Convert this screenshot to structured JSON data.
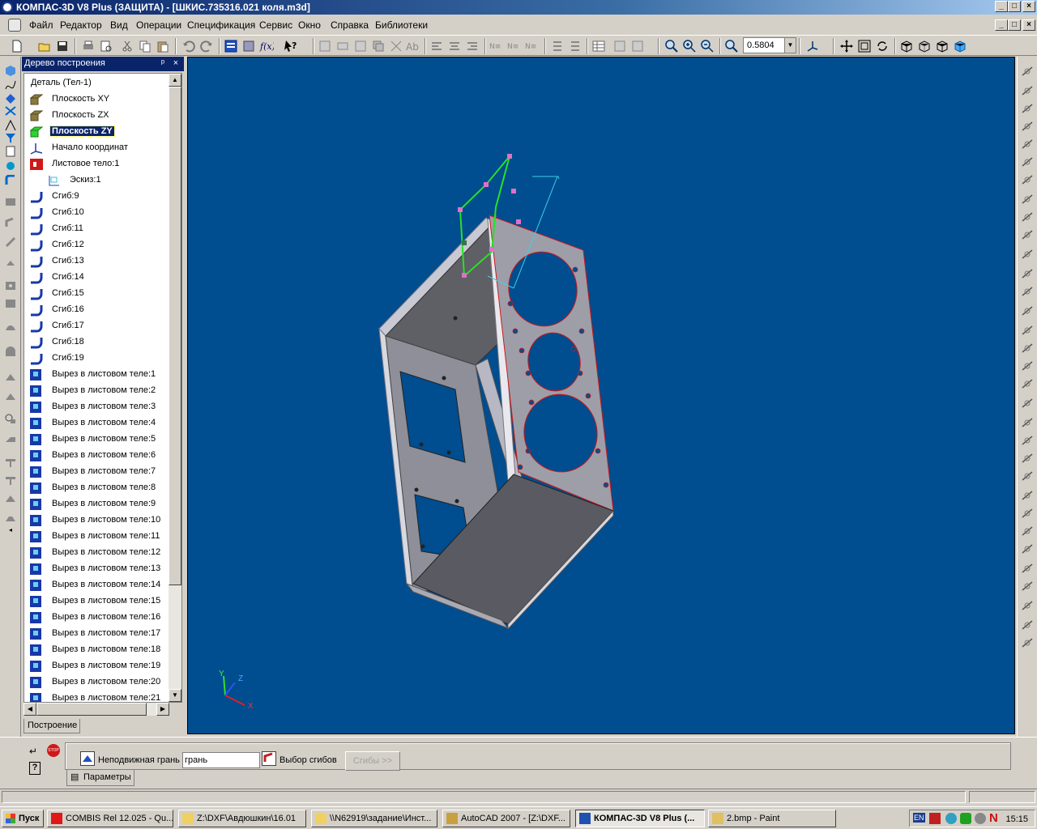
{
  "window": {
    "title": "КОМПАС-3D V8 Plus (ЗАЩИТА) - [ШКИС.735316.021 коля.m3d]",
    "controls": [
      "_",
      "□",
      "×"
    ]
  },
  "menu": {
    "items": [
      "Файл",
      "Редактор",
      "Вид",
      "Операции",
      "Спецификация",
      "Сервис",
      "Окно",
      "Справка",
      "Библиотеки"
    ]
  },
  "toolbar": {
    "zoom_value": "0.5804"
  },
  "tree": {
    "title": "Дерево построения",
    "pin": "ᵖ",
    "close": "×",
    "root": "Деталь (Тел-1)",
    "items": [
      {
        "label": "Плоскость XY",
        "icon": "plane-icon"
      },
      {
        "label": "Плоскость ZX",
        "icon": "plane-icon"
      },
      {
        "label": "Плоскость ZY",
        "icon": "plane-icon",
        "selected": true
      },
      {
        "label": "Начало координат",
        "icon": "origin-icon"
      },
      {
        "label": "Листовое тело:1",
        "icon": "sheet-body-icon"
      },
      {
        "label": "Эскиз:1",
        "icon": "sketch-icon",
        "indent": true
      },
      {
        "label": "Сгиб:9",
        "icon": "bend-icon"
      },
      {
        "label": "Сгиб:10",
        "icon": "bend-icon"
      },
      {
        "label": "Сгиб:11",
        "icon": "bend-icon"
      },
      {
        "label": "Сгиб:12",
        "icon": "bend-icon"
      },
      {
        "label": "Сгиб:13",
        "icon": "bend-icon"
      },
      {
        "label": "Сгиб:14",
        "icon": "bend-icon"
      },
      {
        "label": "Сгиб:15",
        "icon": "bend-icon"
      },
      {
        "label": "Сгиб:16",
        "icon": "bend-icon"
      },
      {
        "label": "Сгиб:17",
        "icon": "bend-icon"
      },
      {
        "label": "Сгиб:18",
        "icon": "bend-icon"
      },
      {
        "label": "Сгиб:19",
        "icon": "bend-icon"
      },
      {
        "label": "Вырез в листовом теле:1",
        "icon": "cutout-icon"
      },
      {
        "label": "Вырез в листовом теле:2",
        "icon": "cutout-icon"
      },
      {
        "label": "Вырез в листовом теле:3",
        "icon": "cutout-icon"
      },
      {
        "label": "Вырез в листовом теле:4",
        "icon": "cutout-icon"
      },
      {
        "label": "Вырез в листовом теле:5",
        "icon": "cutout-icon"
      },
      {
        "label": "Вырез в листовом теле:6",
        "icon": "cutout-icon"
      },
      {
        "label": "Вырез в листовом теле:7",
        "icon": "cutout-icon"
      },
      {
        "label": "Вырез в листовом теле:8",
        "icon": "cutout-icon"
      },
      {
        "label": "Вырез в листовом теле:9",
        "icon": "cutout-icon"
      },
      {
        "label": "Вырез в листовом теле:10",
        "icon": "cutout-icon"
      },
      {
        "label": "Вырез в листовом теле:11",
        "icon": "cutout-icon"
      },
      {
        "label": "Вырез в листовом теле:12",
        "icon": "cutout-icon"
      },
      {
        "label": "Вырез в листовом теле:13",
        "icon": "cutout-icon"
      },
      {
        "label": "Вырез в листовом теле:14",
        "icon": "cutout-icon"
      },
      {
        "label": "Вырез в листовом теле:15",
        "icon": "cutout-icon"
      },
      {
        "label": "Вырез в листовом теле:16",
        "icon": "cutout-icon"
      },
      {
        "label": "Вырез в листовом теле:17",
        "icon": "cutout-icon"
      },
      {
        "label": "Вырез в листовом теле:18",
        "icon": "cutout-icon"
      },
      {
        "label": "Вырез в листовом теле:19",
        "icon": "cutout-icon"
      },
      {
        "label": "Вырез в листовом теле:20",
        "icon": "cutout-icon"
      },
      {
        "label": "Вырез в листовом теле:21",
        "icon": "cutout-icon"
      }
    ],
    "tab_label": "Построение"
  },
  "viewport": {
    "axes": {
      "x": "X",
      "y": "Y",
      "z": "Z"
    },
    "background": "#004d8f"
  },
  "properties": {
    "fixed_face_label": "Неподвижная грань",
    "fixed_face_value": "грань",
    "select_bends_label": "Выбор сгибов",
    "bends_button": "Сгибы >>",
    "tab_label": "Параметры"
  },
  "taskbar": {
    "start": "Пуск",
    "tasks": [
      {
        "label": "COMBIS Rel 12.025 - Qu...",
        "icon": "combis-icon"
      },
      {
        "label": "Z:\\DXF\\Авдюшкин\\16.01",
        "icon": "folder-icon"
      },
      {
        "label": "\\\\N62919\\задание\\Инст...",
        "icon": "folder-icon"
      },
      {
        "label": "AutoCAD 2007 - [Z:\\DXF...",
        "icon": "autocad-icon"
      },
      {
        "label": "КОМПАС-3D V8 Plus (...",
        "icon": "kompas-icon",
        "active": true
      },
      {
        "label": "2.bmp - Paint",
        "icon": "paint-icon"
      }
    ],
    "tray_lang": "EN",
    "clock": "15:15"
  }
}
